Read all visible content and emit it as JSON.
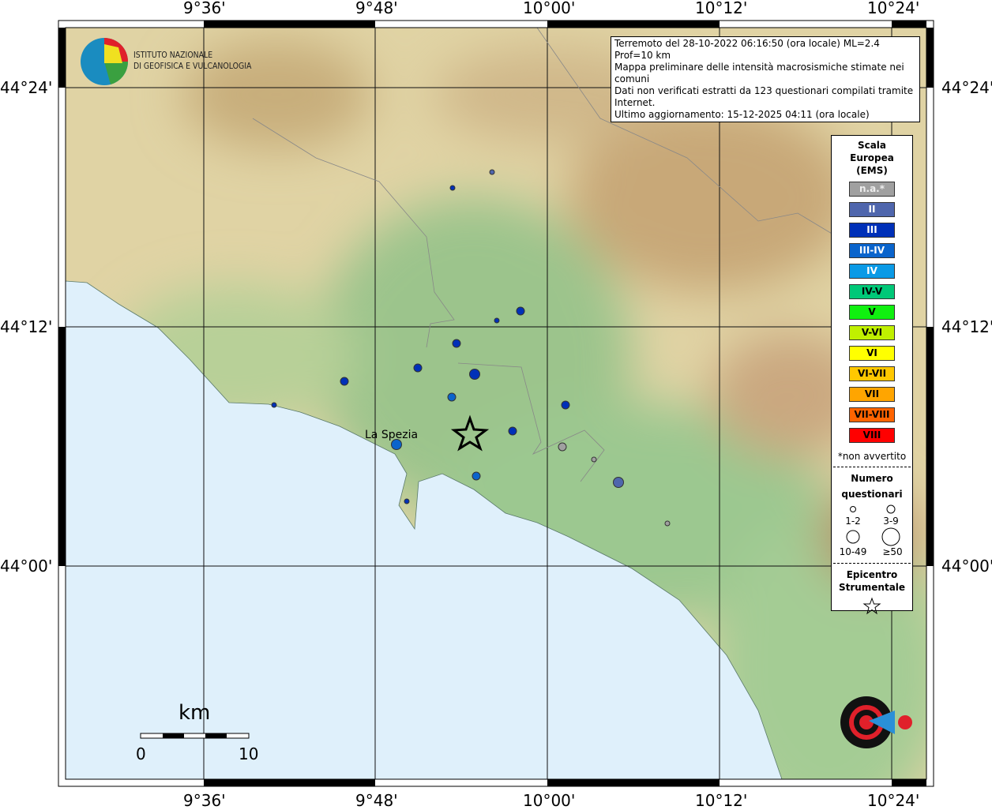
{
  "lon_labels": [
    "9°36'",
    "9°48'",
    "10°00'",
    "10°12'",
    "10°24'"
  ],
  "lat_labels": [
    "44°24'",
    "44°12'",
    "44°00'"
  ],
  "logo": {
    "line1": "ISTITUTO NAZIONALE",
    "line2": "DI GEOFISICA E VULCANOLOGIA"
  },
  "info": [
    "Terremoto del 28-10-2022 06:16:50 (ora locale) ML=2.4 Prof=10 km",
    "Mappa preliminare delle intensità macrosismiche stimate nei comuni",
    "Dati non verificati estratti da 123 questionari compilati tramite Internet.",
    "Ultimo aggiornamento: 15-12-2025 04:11 (ora locale)"
  ],
  "legend": {
    "title": [
      "Scala",
      "Europea",
      "(EMS)"
    ],
    "scale": [
      {
        "label": "n.a.*",
        "color": "#a0a0a0"
      },
      {
        "label": "II",
        "color": "#4f66ad"
      },
      {
        "label": "III",
        "color": "#0030b8"
      },
      {
        "label": "III-IV",
        "color": "#0a64cc"
      },
      {
        "label": "IV",
        "color": "#0a9ae6"
      },
      {
        "label": "IV-V",
        "color": "#00c878"
      },
      {
        "label": "V",
        "color": "#10f010"
      },
      {
        "label": "V-VI",
        "color": "#c0f000"
      },
      {
        "label": "VI",
        "color": "#ffff00"
      },
      {
        "label": "VI-VII",
        "color": "#ffc800"
      },
      {
        "label": "VII",
        "color": "#ffa500"
      },
      {
        "label": "VII-VIII",
        "color": "#ff6400"
      },
      {
        "label": "VIII",
        "color": "#ff0000"
      }
    ],
    "note": "*non avvertito",
    "count_title": [
      "Numero",
      "questionari"
    ],
    "count_classes": [
      "1-2",
      "3-9",
      "10-49",
      "≥50"
    ],
    "epi_title": [
      "Epicentro",
      "Strumentale"
    ]
  },
  "city": "La Spezia",
  "scalebar": {
    "unit": "km",
    "min": "0",
    "max": "10"
  },
  "hsit_logo": "www.haisentito/terremoto.it"
}
